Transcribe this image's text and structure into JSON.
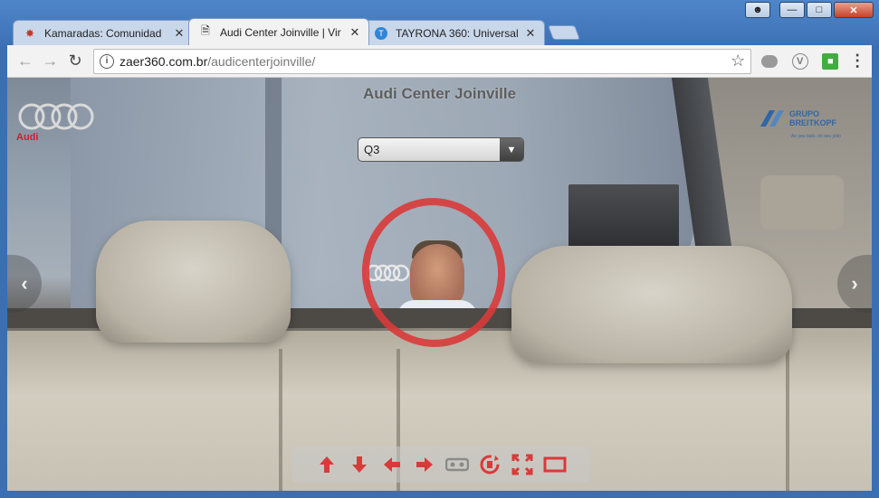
{
  "browser": {
    "tabs": [
      {
        "title": "Kamaradas: Comunidad",
        "icon": "kamaradas-favicon",
        "active": false
      },
      {
        "title": "Audi Center Joinville | Vir",
        "icon": "page-favicon",
        "active": true
      },
      {
        "title": "TAYRONA 360: Universal",
        "icon": "tayrona-favicon",
        "active": false
      }
    ],
    "url_domain": "zaer360.com.br",
    "url_path": "/audicenterjoinville/"
  },
  "page": {
    "title": "Audi Center Joinville",
    "brand_word": "Audi",
    "dealer_logo": {
      "line1": "GRUPO",
      "line2": "BREITKOPF",
      "tagline": "Ao seu lado, do seu jeito"
    },
    "model_select": {
      "value": "Q3"
    }
  },
  "controls": [
    "arrow-up-icon",
    "arrow-down-icon",
    "arrow-left-icon",
    "arrow-right-icon",
    "vr-glasses-icon",
    "auto-rotate-icon",
    "fullscreen-icon",
    "hide-controls-icon"
  ],
  "colors": {
    "accent": "#d93a3a",
    "audi_red": "#cc1f2f",
    "dealer_blue": "#1f5fa8"
  }
}
